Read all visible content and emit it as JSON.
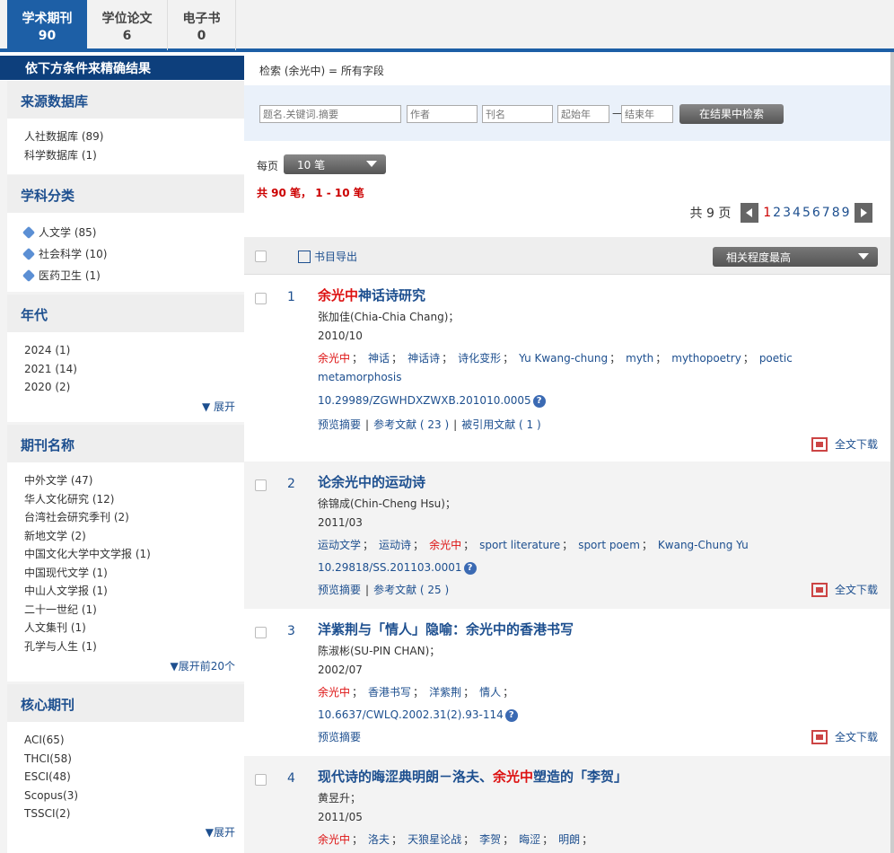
{
  "tabs": [
    {
      "label": "学术期刊",
      "count": "90"
    },
    {
      "label": "学位论文",
      "count": "6"
    },
    {
      "label": "电子书",
      "count": "0"
    }
  ],
  "sidebar": {
    "header": "依下方条件来精确结果",
    "sections": [
      {
        "title": "来源数据库",
        "items": [
          "人社数据库 (89)",
          "科学数据库 (1)"
        ]
      },
      {
        "title": "学科分类",
        "items": [
          "人文学 (85)",
          "社会科学 (10)",
          "医药卫生 (1)"
        ]
      },
      {
        "title": "年代",
        "items": [
          "2024 (1)",
          "2021 (14)",
          "2020 (2)"
        ],
        "expand": "▼ 展开"
      },
      {
        "title": "期刊名称",
        "items": [
          "中外文学 (47)",
          "华人文化研究 (12)",
          "台湾社会研究季刊 (2)",
          "新地文学 (2)",
          "中国文化大学中文学报 (1)",
          "中国现代文学 (1)",
          "中山人文学报 (1)",
          "二十一世纪 (1)",
          "人文集刊 (1)",
          "孔学与人生 (1)"
        ],
        "expand": "▼展开前20个"
      },
      {
        "title": "核心期刊",
        "items": [
          "ACI(65)",
          "THCI(58)",
          "ESCI(48)",
          "Scopus(3)",
          "TSSCI(2)"
        ],
        "expand": "▼展开"
      }
    ]
  },
  "main": {
    "crumb": "检索 (余光中) = 所有字段",
    "search": {
      "p1": "题名.关键词.摘要",
      "p2": "作者",
      "p3": "刊名",
      "p4": "起始年",
      "p5": "结束年",
      "dash": "—",
      "button": "在结果中检索"
    },
    "perpage_label": "每页",
    "perpage_value": "10 笔",
    "summary": "共 90 笔， 1 - 10 笔",
    "pager": {
      "label": "共 9 页",
      "pages": [
        "1",
        "2",
        "3",
        "4",
        "5",
        "6",
        "7",
        "8",
        "9"
      ],
      "current": "1"
    },
    "export": "书目导出",
    "sort": "相关程度最高",
    "records": [
      {
        "num": "1",
        "title_hl": "余光中",
        "title_rest": "神话诗研究",
        "author": "张加佳(Chia-Chia Chang)；",
        "date": "2010/10",
        "keywords_line1": "余光中；神话；神话诗；诗化变形；Yu Kwang-chung；myth；mythopoetry；poetic",
        "keywords_line2": "metamorphosis",
        "doi": "10.29989/ZGWHDXZWXB.201010.0005",
        "links": [
          "预览摘要",
          "参考文献 ( 23 )",
          "被引用文献 ( 1 )"
        ],
        "download": "全文下载"
      },
      {
        "num": "2",
        "title": "论余光中的运动诗",
        "author": "徐锦成(Chin-Cheng Hsu)；",
        "date": "2011/03",
        "doi": "10.29818/SS.201103.0001",
        "links": [
          "预览摘要",
          "参考文献 ( 25 )"
        ],
        "download": "全文下载"
      },
      {
        "num": "3",
        "title": "洋紫荆与「情人」隐喻：余光中的香港书写",
        "author": "陈淑彬(SU-PIN CHAN)；",
        "date": "2002/07",
        "doi": "10.6637/CWLQ.2002.31(2).93-114",
        "links": [
          "预览摘要"
        ],
        "download": "全文下载"
      },
      {
        "num": "4",
        "title_pre": "现代诗的晦涩典明朗－洛夫、",
        "title_hl": "余光中",
        "title_post": "塑造的「李贺」",
        "author": "黄昱升；",
        "date": "2011/05"
      }
    ],
    "kw1": [
      "余光中",
      "神话",
      "神话诗",
      "诗化变形",
      "Yu Kwang-chung",
      "myth",
      "mythopoetry",
      "poetic"
    ],
    "kw2": [
      "运动文学",
      "运动诗",
      "余光中",
      "sport literature",
      "sport poem",
      "Kwang-Chung Yu"
    ],
    "kw3": [
      "余光中",
      "香港书写",
      "洋紫荆",
      "情人"
    ],
    "kw4": [
      "余光中",
      "洛夫",
      "天狼星论战",
      "李贺",
      "晦涩",
      "明朗"
    ]
  },
  "colors": {
    "accent": "#1d5fa6",
    "highlight": "#d11",
    "link": "#1d4f8f"
  }
}
